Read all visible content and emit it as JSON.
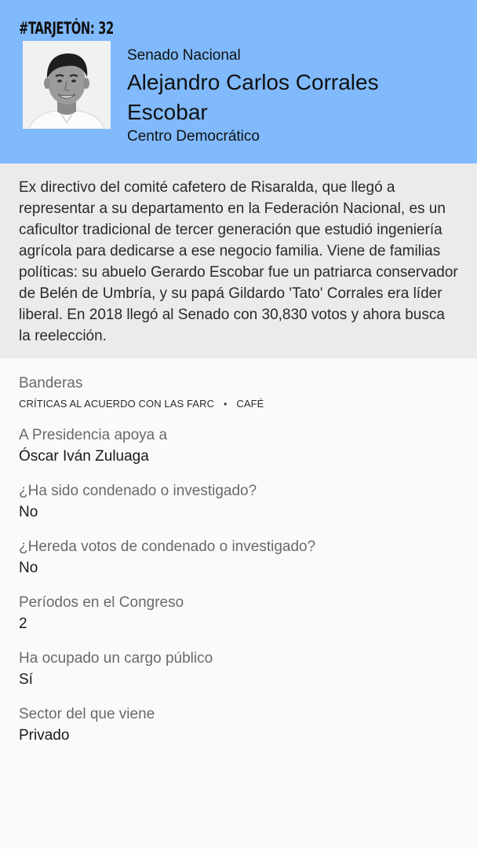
{
  "header": {
    "brand": "#TARJETÓN: 32",
    "chamber": "Senado Nacional",
    "name": "Alejandro Carlos Corrales Escobar",
    "party": "Centro Democrático",
    "background": "#80bafc"
  },
  "bio": {
    "text": "Ex directivo del comité cafetero de Risaralda, que llegó a representar a su departamento en la Federación Nacional, es un caficultor tradicional de tercer generación que estudió ingeniería agrícola para dedicarse a ese negocio familia. Viene de familias políticas: su abuelo Gerardo Escobar fue un patriarca conservador de Belén de Umbría, y su papá Gildardo 'Tato' Corrales era líder liberal. En 2018 llegó al Senado con 30,830 votos y ahora busca la reelección."
  },
  "banderas": {
    "label": "Banderas",
    "tags": [
      "Críticas al acuerdo con las FARC",
      "Café"
    ],
    "separator": "•"
  },
  "details": [
    {
      "label": "A Presidencia apoya a",
      "value": "Óscar Iván Zuluaga"
    },
    {
      "label": "¿Ha sido condenado o investigado?",
      "value": "No"
    },
    {
      "label": "¿Hereda votos de condenado o investigado?",
      "value": "No"
    },
    {
      "label": "Períodos en el Congreso",
      "value": "2"
    },
    {
      "label": "Ha ocupado un cargo público",
      "value": "Sí"
    },
    {
      "label": "Sector del que viene",
      "value": "Privado"
    }
  ]
}
